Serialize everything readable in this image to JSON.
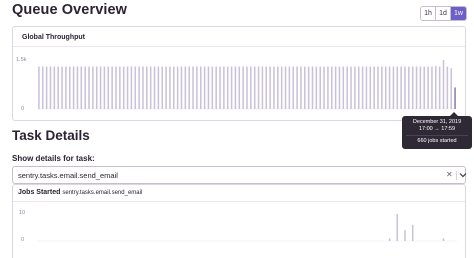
{
  "header": {
    "title": "Queue Overview",
    "ranges": [
      {
        "label": "1h",
        "active": false
      },
      {
        "label": "1d",
        "active": false
      },
      {
        "label": "1w",
        "active": true
      }
    ]
  },
  "throughput_panel": {
    "title": "Global Throughput",
    "y_ticks": [
      "1.5k",
      "0"
    ]
  },
  "tooltip": {
    "date": "December 31, 2019",
    "time": "17:00 → 17:59",
    "value": "660 jobs started"
  },
  "task_details": {
    "title": "Task Details",
    "field_label": "Show details for task:",
    "selected_task": "sentry.tasks.email.send_email",
    "clear_icon": "close-icon",
    "dropdown_icon": "chevron-down-icon"
  },
  "jobs_panel": {
    "title": "Jobs Started",
    "subtitle": "sentry.tasks.email.send_email",
    "y_ticks": [
      "10",
      "0"
    ]
  },
  "colors": {
    "accent": "#6c5fc7",
    "bar": "#c9c2d9",
    "tooltip_bg": "#2f2936"
  },
  "chart_data": [
    {
      "type": "bar",
      "title": "Global Throughput",
      "ylim": [
        0,
        1500
      ],
      "y_ticks": [
        "1.5k",
        "0"
      ],
      "values": [
        1300,
        1300,
        1300,
        1300,
        1300,
        1300,
        1300,
        1300,
        1300,
        1300,
        1300,
        1300,
        1300,
        1300,
        1300,
        1300,
        1300,
        1300,
        1300,
        1300,
        1300,
        1300,
        1300,
        1300,
        1300,
        1300,
        1300,
        1300,
        1300,
        1300,
        1300,
        1300,
        1300,
        1300,
        1300,
        1300,
        1300,
        1300,
        1300,
        1300,
        1300,
        1300,
        1300,
        1300,
        1300,
        1300,
        1300,
        1300,
        1300,
        1300,
        1300,
        1300,
        1300,
        1300,
        1300,
        1300,
        1300,
        1300,
        1300,
        1300,
        1300,
        1300,
        1300,
        1300,
        1300,
        1300,
        1300,
        1300,
        1300,
        1300,
        1300,
        1300,
        1300,
        1300,
        1300,
        1300,
        1300,
        1300,
        1300,
        1300,
        1300,
        1300,
        1300,
        1300,
        1300,
        1300,
        1300,
        1300,
        1300,
        1300,
        1300,
        1300,
        1300,
        1300,
        1300,
        1300,
        1300,
        1300,
        1300,
        1300,
        1300,
        1300,
        1300,
        1310,
        1300,
        1500,
        1300,
        1250,
        660
      ],
      "highlight_index": 108
    },
    {
      "type": "bar",
      "title": "Jobs Started",
      "ylim": [
        0,
        10
      ],
      "y_ticks": [
        "10",
        "0"
      ],
      "values": [
        0,
        0,
        0,
        0,
        0,
        0,
        0,
        0,
        0,
        0,
        0,
        0,
        0,
        0,
        0,
        0,
        0,
        0,
        0,
        0,
        0,
        0,
        0,
        0,
        0,
        0,
        0,
        0,
        0,
        0,
        0,
        0,
        0,
        0,
        0,
        0,
        0,
        0,
        0,
        0,
        0,
        0,
        0,
        0,
        0,
        0,
        0,
        0,
        0,
        0,
        0,
        0,
        0,
        0,
        0,
        0,
        0,
        0,
        0,
        0,
        0,
        0,
        0,
        0,
        0,
        0,
        0,
        0,
        0,
        0,
        0,
        0,
        0,
        0,
        0,
        0,
        0,
        0,
        0,
        0,
        0,
        0,
        0,
        0,
        0,
        0,
        0,
        0,
        0,
        0,
        0,
        1,
        0,
        10,
        0,
        4,
        0,
        6,
        0,
        0,
        0,
        0,
        0,
        0,
        0,
        1,
        0,
        0,
        0
      ]
    }
  ]
}
